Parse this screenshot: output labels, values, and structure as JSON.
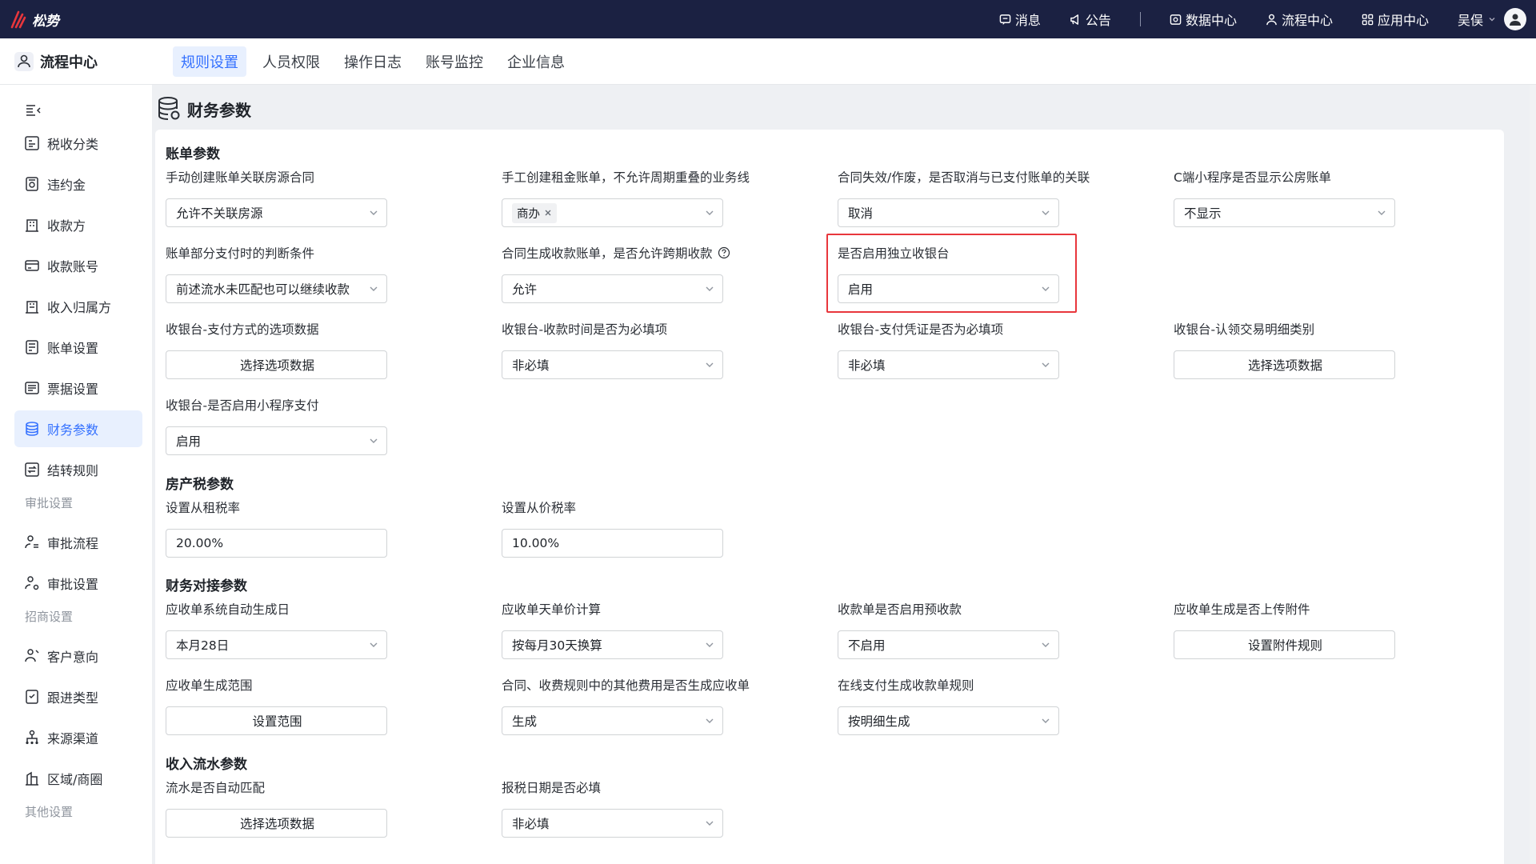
{
  "brand": {
    "name": "松势"
  },
  "topnav": {
    "items": [
      {
        "label": "消息",
        "icon": "message-icon"
      },
      {
        "label": "公告",
        "icon": "megaphone-icon"
      },
      {
        "label": "数据中心",
        "icon": "data-center-icon"
      },
      {
        "label": "流程中心",
        "icon": "flow-center-icon"
      },
      {
        "label": "应用中心",
        "icon": "app-grid-icon"
      }
    ],
    "user": {
      "name": "吴俣"
    }
  },
  "module": {
    "name": "流程中心"
  },
  "tabs": [
    {
      "label": "规则设置",
      "active": true
    },
    {
      "label": "人员权限",
      "active": false
    },
    {
      "label": "操作日志",
      "active": false
    },
    {
      "label": "账号监控",
      "active": false
    },
    {
      "label": "企业信息",
      "active": false
    }
  ],
  "sidebar": {
    "items": [
      {
        "label": "税收分类"
      },
      {
        "label": "违约金"
      },
      {
        "label": "收款方"
      },
      {
        "label": "收款账号"
      },
      {
        "label": "收入归属方"
      },
      {
        "label": "账单设置"
      },
      {
        "label": "票据设置"
      },
      {
        "label": "财务参数",
        "active": true
      },
      {
        "label": "结转规则"
      },
      {
        "label": "审批流程"
      },
      {
        "label": "审批设置"
      },
      {
        "label": "客户意向"
      },
      {
        "label": "跟进类型"
      },
      {
        "label": "来源渠道"
      },
      {
        "label": "区域/商圈"
      }
    ],
    "groups": [
      "审批设置",
      "招商设置",
      "其他设置"
    ]
  },
  "page": {
    "title": "财务参数"
  },
  "sections": {
    "bill": {
      "title": "账单参数",
      "fields": [
        {
          "label": "手动创建账单关联房源合同",
          "value": "允许不关联房源"
        },
        {
          "label": "手工创建租金账单，不允许周期重叠的业务线",
          "tag": "商办"
        },
        {
          "label": "合同失效/作废，是否取消与已支付账单的关联",
          "value": "取消"
        },
        {
          "label": "C端小程序是否显示公房账单",
          "value": "不显示"
        },
        {
          "label": "账单部分支付时的判断条件",
          "value": "前述流水未匹配也可以继续收款"
        },
        {
          "label": "合同生成收款账单，是否允许跨期收款",
          "value": "允许"
        },
        {
          "label": "是否启用独立收银台",
          "value": "启用"
        },
        {
          "label": "收银台-支付方式的选项数据",
          "button": "选择选项数据"
        },
        {
          "label": "收银台-收款时间是否为必填项",
          "value": "非必填"
        },
        {
          "label": "收银台-支付凭证是否为必填项",
          "value": "非必填"
        },
        {
          "label": "收银台-认领交易明细类别",
          "button": "选择选项数据"
        },
        {
          "label": "收银台-是否启用小程序支付",
          "value": "启用"
        }
      ]
    },
    "property_tax": {
      "title": "房产税参数",
      "fields": [
        {
          "label": "设置从租税率",
          "value": "20.00%"
        },
        {
          "label": "设置从价税率",
          "value": "10.00%"
        }
      ]
    },
    "finance_link": {
      "title": "财务对接参数",
      "fields": [
        {
          "label": "应收单系统自动生成日",
          "value": "本月28日"
        },
        {
          "label": "应收单天单价计算",
          "value": "按每月30天换算"
        },
        {
          "label": "收款单是否启用预收款",
          "value": "不启用"
        },
        {
          "label": "应收单生成是否上传附件",
          "button": "设置附件规则"
        },
        {
          "label": "应收单生成范围",
          "button": "设置范围"
        },
        {
          "label": "合同、收费规则中的其他费用是否生成应收单",
          "value": "生成"
        },
        {
          "label": "在线支付生成收款单规则",
          "value": "按明细生成"
        }
      ]
    },
    "income_flow": {
      "title": "收入流水参数",
      "fields": [
        {
          "label": "流水是否自动匹配",
          "button": "选择选项数据"
        },
        {
          "label": "报税日期是否必填",
          "value": "非必填"
        }
      ]
    }
  },
  "colors": {
    "topbar": "#1b2142",
    "accent": "#3370ff",
    "highlight": "#e8363c"
  }
}
